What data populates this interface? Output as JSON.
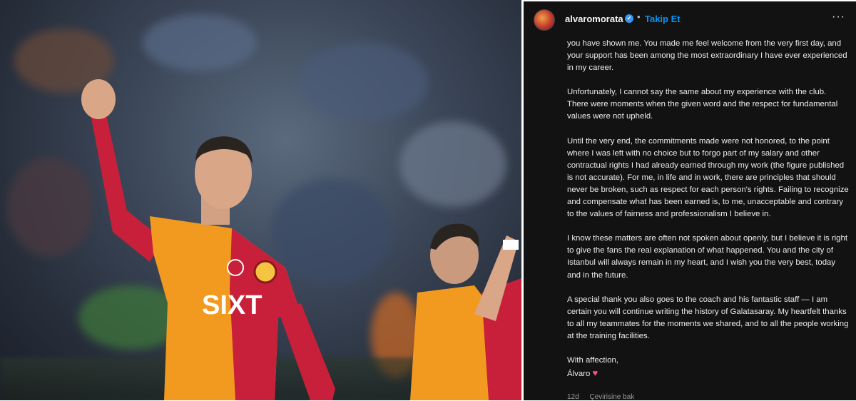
{
  "post": {
    "username": "alvaromorata",
    "verified_badge": "✔",
    "separator": "•",
    "follow_label": "Takip Et",
    "more_label": "···",
    "paragraphs": [
      "you have shown me. You made me feel welcome from the very first day, and your support has been among the most extraordinary I have ever experienced in my career.",
      "Unfortunately, I cannot say the same about my experience with the club. There were moments when the given word and the respect for fundamental values were not upheld.",
      "Until the very end, the commitments made were not honored, to the point where I was left with no choice but to forgo part of my salary and other contractual rights I had already earned through my work (the figure published is not accurate). For me, in life and in work, there are principles that should never be broken, such as respect for each person's rights. Failing to recognize and compensate what has been earned is, to me, unacceptable and contrary to the values of fairness and professionalism I believe in.",
      "I know these matters are often not spoken about openly, but I believe it is right to give the fans the real explanation of what happened. You and the city of Istanbul will always remain in my heart, and I wish you the very best, today and in the future.",
      "A special thank you also goes to the coach and his fantastic staff — I am certain you will continue writing the history of Galatasaray. My heartfelt thanks to all my teammates for the moments we shared, and to all the people working at the training facilities."
    ],
    "closing": "With affection,",
    "signature": "Álvaro",
    "heart": "♥",
    "age": "12d",
    "translate_label": "Çevirisine bak"
  },
  "photo": {
    "jersey_sponsor": "SIXT",
    "colors": {
      "orange": "#f29a1f",
      "red": "#c8203a"
    }
  }
}
